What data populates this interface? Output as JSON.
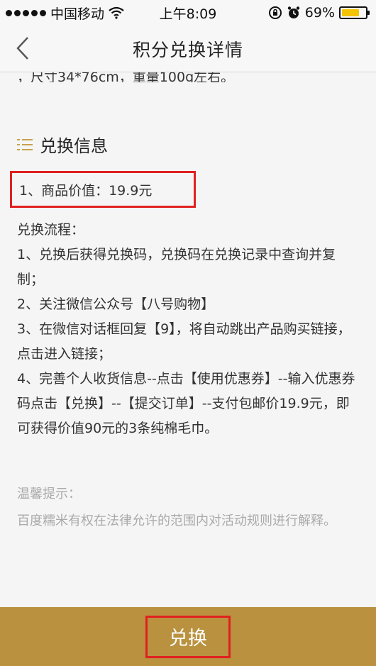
{
  "status_bar": {
    "carrier": "中国移动",
    "time": "上午8:09",
    "battery": "69%",
    "battery_level": 0.69
  },
  "nav": {
    "title": "积分兑换详情"
  },
  "content": {
    "cut_line": "，尺寸34*76cm，重量100g左右。",
    "section_title": "兑换信息",
    "value_line": "1、商品价值：19.9元",
    "flow_label": "兑换流程：",
    "steps": [
      "1、兑换后获得兑换码，兑换码在兑换记录中查询并复制；",
      "2、关注微信公众号【八号购物】",
      "3、在微信对话框回复【9】，将自动跳出产品购买链接，点击进入链接；",
      "4、完善个人收货信息--点击【使用优惠券】--输入优惠券码点击【兑换】--【提交订单】--支付包邮价19.9元，即可获得价值90元的3条纯棉毛巾。"
    ],
    "tips_title": "温馨提示：",
    "tips_body": "百度糯米有权在法律允许的范围内对活动规则进行解释。"
  },
  "bottom": {
    "exchange_label": "兑换"
  },
  "colors": {
    "accent": "#b9913f",
    "highlight_border": "#e02020",
    "icon_gold": "#c8a24a"
  }
}
